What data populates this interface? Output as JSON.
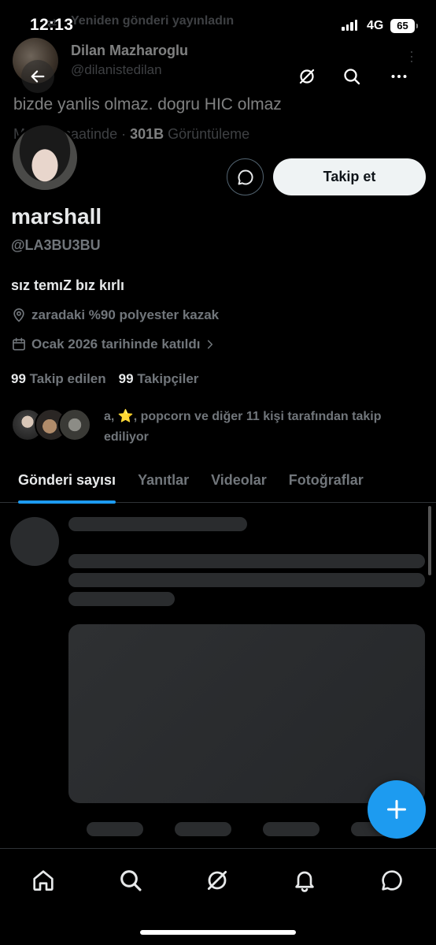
{
  "status_bar": {
    "time": "12:13",
    "network": "4G",
    "battery": "65"
  },
  "underlying_tweet": {
    "repost_label": "Yeniden gönderi yayınladın",
    "author_name": "Dilan Mazharoglu",
    "author_handle": "@dilanistedilan",
    "text": "bizde yanlis olmaz. dogru HIC olmaz",
    "date": "May 25 saatinde · ",
    "views_count": "301B",
    "views_label": " Görüntüleme"
  },
  "header": {
    "back_icon": "arrow-left-icon",
    "grok_icon": "grok-icon",
    "search_icon": "search-icon",
    "more_icon": "more-dots-icon"
  },
  "profile": {
    "display_name": "marshall",
    "handle": "@LA3BU3BU",
    "bio": "sız temıZ bız kırlı",
    "location": "zaradaki %90 polyester kazak",
    "joined": "Ocak 2026 tarihinde katıldı",
    "following_count": "99",
    "following_label": "Takip edilen",
    "followers_count": "99",
    "followers_label": "Takipçiler",
    "mutual_followers": "a, ⭐, popcorn ve diğer 11 kişi tarafından takip ediliyor",
    "follow_button": "Takip et"
  },
  "tabs": [
    {
      "label": "Gönderi sayısı",
      "active": true
    },
    {
      "label": "Yanıtlar",
      "active": false
    },
    {
      "label": "Videolar",
      "active": false
    },
    {
      "label": "Fotoğraflar",
      "active": false
    }
  ],
  "bottom_nav": [
    "home-icon",
    "search-icon",
    "grok-icon",
    "notifications-bell-icon",
    "messages-icon"
  ],
  "colors": {
    "accent": "#1d9bf0",
    "background": "#000000",
    "muted": "#71767b",
    "text": "#e7e9ea"
  }
}
